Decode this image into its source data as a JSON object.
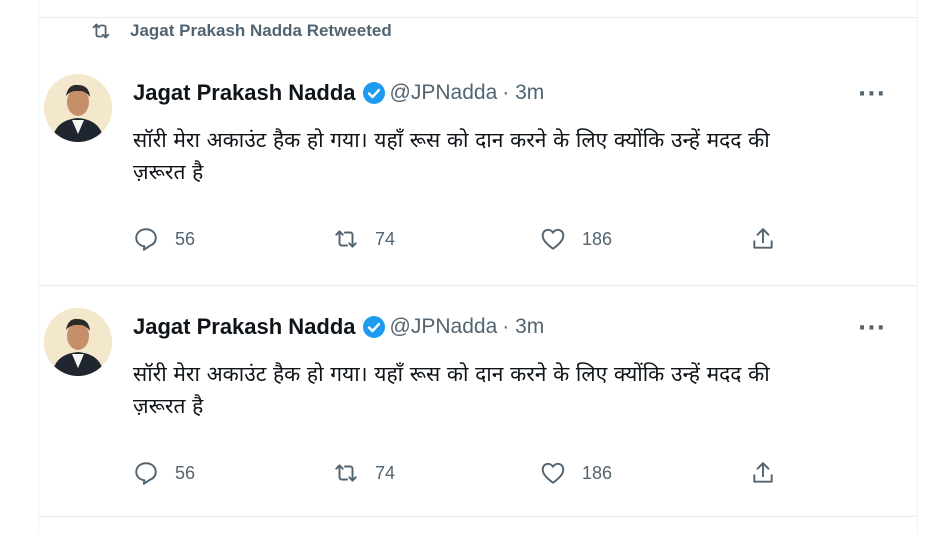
{
  "retweet_banner": {
    "icon": "retweet-icon",
    "text": "Jagat Prakash Nadda Retweeted"
  },
  "tweets": [
    {
      "name": "Jagat Prakash Nadda",
      "verified": true,
      "handle": "@JPNadda",
      "time": "· 3m",
      "text_line1": "सॉरी मेरा अकाउंट हैक हो गया। यहाँ रूस को दान करने के लिए क्योंकि उन्हें मदद की",
      "text_line2": "ज़रूरत है",
      "replies": "56",
      "retweets": "74",
      "likes": "186",
      "more": "···"
    },
    {
      "name": "Jagat Prakash Nadda",
      "verified": true,
      "handle": "@JPNadda",
      "time": "· 3m",
      "text_line1": "सॉरी मेरा अकाउंट हैक हो गया। यहाँ रूस को दान करने के लिए क्योंकि उन्हें मदद की",
      "text_line2": "ज़रूरत है",
      "replies": "56",
      "retweets": "74",
      "likes": "186",
      "more": "···"
    }
  ],
  "colors": {
    "text": "#0f1419",
    "muted": "#536471",
    "verified": "#1d9bf0",
    "divider": "#e6ecf0"
  }
}
